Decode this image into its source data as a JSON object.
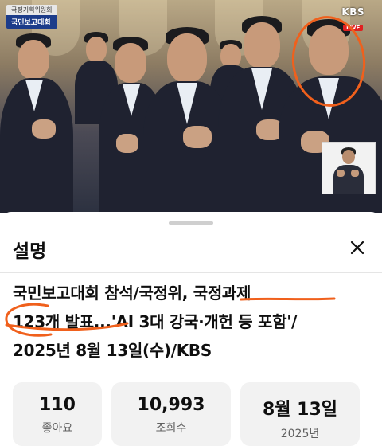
{
  "video": {
    "broadcast_badge": {
      "top": "국정기획위원회",
      "bottom": "국민보고대회"
    },
    "channel_logo": "KBS",
    "live_label": "LIVE"
  },
  "description_sheet": {
    "title": "설명",
    "video_title_lines": [
      "국민보고대회 참석/국정위, 국정과제",
      "123개 발표...'AI 3대 강국·개헌 등 포함'/",
      "2025년 8월 13일(수)/KBS"
    ],
    "stats": [
      {
        "value": "110",
        "label": "좋아요"
      },
      {
        "value": "10,993",
        "label": "조회수"
      },
      {
        "value": "8월 13일",
        "label": "2025년"
      }
    ]
  },
  "colors": {
    "annotation": "#f0601c",
    "badge_blue": "#1c3c8a",
    "live_red": "#e02020"
  }
}
